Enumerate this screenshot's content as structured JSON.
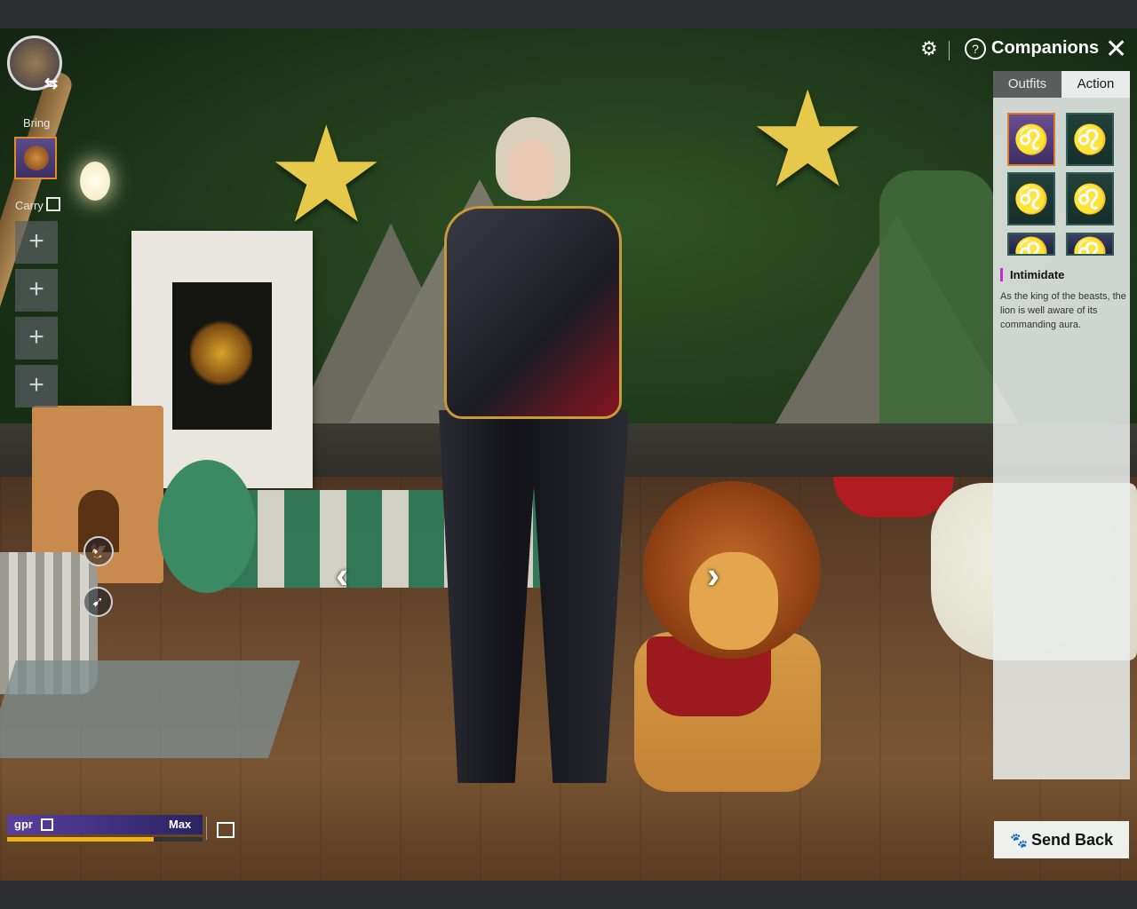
{
  "header": {
    "title": "Companions",
    "settings_icon": "gear-icon",
    "help_icon": "help-icon",
    "close_icon": "close-icon"
  },
  "left_panel": {
    "bring_label": "Bring",
    "carry_label": "Carry",
    "carry_slots": [
      "+",
      "+",
      "+",
      "+"
    ]
  },
  "tabs": [
    {
      "label": "Outfits",
      "active": false
    },
    {
      "label": "Action",
      "active": true
    }
  ],
  "actions": {
    "thumbnails": [
      "lion-icon",
      "lion-icon",
      "lion-icon",
      "lion-icon",
      "lion-icon",
      "lion-icon"
    ],
    "selected_index": 0,
    "selected_name": "Intimidate",
    "selected_description": "As the king of the beasts, the lion is well aware of its commanding aura."
  },
  "companion": {
    "name": "gpr",
    "level_label": "Max",
    "xp_fraction": 0.75
  },
  "send_back_label": "Send Back",
  "colors": {
    "accent_orange": "#e0782a",
    "purple": "#5a3f9e",
    "xp_yellow": "#f0b419",
    "action_marker": "#c12bd0"
  }
}
